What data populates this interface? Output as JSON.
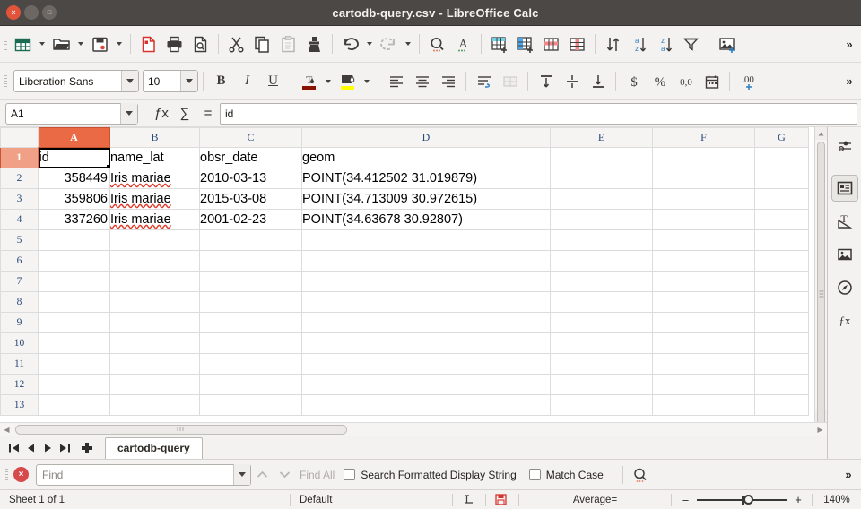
{
  "window": {
    "title": "cartodb-query.csv - LibreOffice Calc",
    "close_label": "×",
    "minimize_label": "–",
    "maximize_label": "□"
  },
  "toolbar_main": {
    "overflow_label": "»",
    "items": [
      {
        "name": "new-document",
        "icon": "new-spreadsheet-icon",
        "disabled": false,
        "dropdown": true
      },
      {
        "name": "open-document",
        "icon": "open-folder-icon",
        "disabled": false,
        "dropdown": true
      },
      {
        "name": "save-document",
        "icon": "save-disk-icon",
        "disabled": false,
        "dropdown": true
      },
      {
        "name": "export-pdf",
        "icon": "pdf-icon",
        "disabled": false,
        "dropdown": false
      },
      {
        "name": "print",
        "icon": "printer-icon",
        "disabled": false,
        "dropdown": false
      },
      {
        "name": "print-preview",
        "icon": "print-preview-icon",
        "disabled": false,
        "dropdown": false
      },
      {
        "name": "cut",
        "icon": "scissors-icon",
        "disabled": false,
        "dropdown": false
      },
      {
        "name": "copy",
        "icon": "copy-icon",
        "disabled": false,
        "dropdown": false
      },
      {
        "name": "paste",
        "icon": "clipboard-icon",
        "disabled": true,
        "dropdown": false
      },
      {
        "name": "clone-formatting",
        "icon": "paintbrush-icon",
        "disabled": false,
        "dropdown": false
      },
      {
        "name": "undo",
        "icon": "undo-arrow-icon",
        "disabled": false,
        "dropdown": true
      },
      {
        "name": "redo",
        "icon": "redo-arrow-icon",
        "disabled": true,
        "dropdown": true
      },
      {
        "name": "find-and-replace",
        "icon": "magnifier-icon",
        "disabled": false,
        "dropdown": false
      },
      {
        "name": "spelling",
        "icon": "spelling-abc-icon",
        "disabled": false,
        "dropdown": false
      },
      {
        "name": "insert-row-above",
        "icon": "insert-row-icon",
        "disabled": false,
        "dropdown": false
      },
      {
        "name": "insert-column-before",
        "icon": "insert-column-icon",
        "disabled": false,
        "dropdown": false
      },
      {
        "name": "delete-rows",
        "icon": "delete-row-icon",
        "disabled": false,
        "dropdown": false
      },
      {
        "name": "delete-columns",
        "icon": "delete-column-icon",
        "disabled": false,
        "dropdown": false
      },
      {
        "name": "sort",
        "icon": "sort-icon",
        "disabled": false,
        "dropdown": false
      },
      {
        "name": "sort-ascending",
        "icon": "sort-az-icon",
        "disabled": false,
        "dropdown": false
      },
      {
        "name": "sort-descending",
        "icon": "sort-za-icon",
        "disabled": false,
        "dropdown": false
      },
      {
        "name": "autofilter",
        "icon": "funnel-icon",
        "disabled": false,
        "dropdown": false
      },
      {
        "name": "insert-image",
        "icon": "image-icon",
        "disabled": false,
        "dropdown": false
      }
    ]
  },
  "toolbar_format": {
    "font_name": "Liberation Sans",
    "font_size": "10",
    "bold_label": "B",
    "italic_label": "I",
    "underline_label": "U",
    "font_color_hex": "#8c1200",
    "highlight_color_hex": "#ffff00",
    "overflow_label": "»",
    "items": [
      {
        "name": "align-left",
        "icon": "align-left-icon",
        "disabled": false
      },
      {
        "name": "align-center",
        "icon": "align-center-icon",
        "disabled": false
      },
      {
        "name": "align-right",
        "icon": "align-right-icon",
        "disabled": false
      },
      {
        "name": "wrap-text",
        "icon": "wrap-text-icon",
        "disabled": false
      },
      {
        "name": "merge-cells",
        "icon": "merge-cells-icon",
        "disabled": true
      },
      {
        "name": "align-top",
        "icon": "align-top-icon",
        "disabled": false
      },
      {
        "name": "align-center-vertically",
        "icon": "align-middle-icon",
        "disabled": false
      },
      {
        "name": "align-bottom",
        "icon": "align-bottom-icon",
        "disabled": false
      },
      {
        "name": "format-currency",
        "icon": "dollar-icon",
        "disabled": false
      },
      {
        "name": "format-percent",
        "icon": "percent-icon",
        "disabled": false
      },
      {
        "name": "format-number",
        "icon": "number-format-icon",
        "disabled": false
      },
      {
        "name": "format-date",
        "icon": "calendar-icon",
        "disabled": false
      },
      {
        "name": "add-decimal-place",
        "icon": "add-decimal-icon",
        "disabled": false
      }
    ]
  },
  "formula_bar": {
    "name_box_value": "A1",
    "function_wizard_label": "ƒx",
    "sum_label": "∑",
    "formula_label": "=",
    "input_value": "id"
  },
  "spreadsheet": {
    "columns": [
      "A",
      "B",
      "C",
      "D",
      "E",
      "F",
      "G"
    ],
    "selected_column": "A",
    "selected_row": "1",
    "active_cell": "A1",
    "rows": [
      "1",
      "2",
      "3",
      "4",
      "5",
      "6",
      "7",
      "8",
      "9",
      "10",
      "11",
      "12",
      "13"
    ],
    "data": [
      {
        "A": "id",
        "B": "name_lat",
        "C": "obsr_date",
        "D": "geom"
      },
      {
        "A": "358449",
        "B": "Iris mariae",
        "C": "2010-03-13",
        "D": "POINT(34.412502 31.019879)"
      },
      {
        "A": "359806",
        "B": "Iris mariae",
        "C": "2015-03-08",
        "D": "POINT(34.713009 30.972615)"
      },
      {
        "A": "337260",
        "B": "Iris mariae",
        "C": "2001-02-23",
        "D": "POINT(34.63678 30.92807)"
      }
    ]
  },
  "sheet_tabs": {
    "first_label": "⏮",
    "prev_label": "◀",
    "next_label": "▶",
    "last_label": "⏭",
    "add_label": "+",
    "tabs": [
      {
        "label": "cartodb-query",
        "active": true
      }
    ]
  },
  "sidebar": {
    "items": [
      {
        "name": "sidebar-settings",
        "icon": "sliders-icon",
        "active": false
      },
      {
        "name": "sidebar-properties",
        "icon": "properties-panel-icon",
        "active": true
      },
      {
        "name": "sidebar-styles",
        "icon": "styles-text-icon",
        "active": false
      },
      {
        "name": "sidebar-gallery",
        "icon": "gallery-image-icon",
        "active": false
      },
      {
        "name": "sidebar-navigator",
        "icon": "compass-navigator-icon",
        "active": false
      },
      {
        "name": "sidebar-functions",
        "icon": "function-fx-icon",
        "active": false
      }
    ]
  },
  "find_bar": {
    "close_label": "×",
    "find_placeholder": "Find",
    "find_value": "",
    "find_previous_label": "⌃",
    "find_next_label": "⌄",
    "find_all_label": "Find All",
    "search_formatted_label": "Search Formatted Display String",
    "search_formatted_checked": false,
    "match_case_label": "Match Case",
    "match_case_checked": false,
    "overflow_label": "»"
  },
  "status_bar": {
    "sheet_info": "Sheet 1 of 1",
    "page_style": "Default",
    "selection_mode_icon": "insert-mode-icon",
    "save_status_icon": "unsaved-changes-icon",
    "average_sum": "Average=",
    "zoom_out_label": "–",
    "zoom_in_label": "+",
    "zoom_level": "140%"
  }
}
